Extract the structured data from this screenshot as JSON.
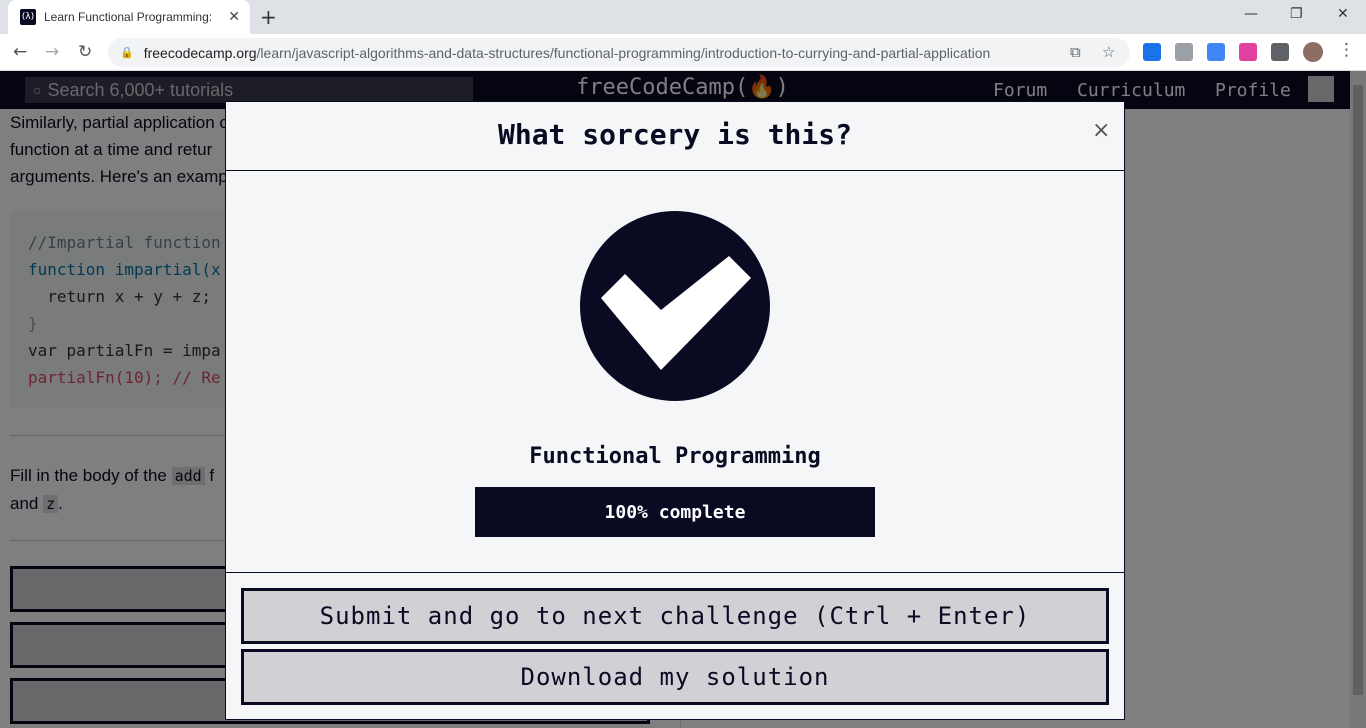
{
  "browser": {
    "tab_title": "Learn Functional Programming: Introduction to Currying and Partial Application",
    "url_host": "freecodecamp.org",
    "url_path": "/learn/javascript-algorithms-and-data-structures/functional-programming/introduction-to-currying-and-partial-application"
  },
  "fcc_nav": {
    "search_placeholder": "Search 6,000+ tutorials",
    "logo": "freeCodeCamp(🔥)",
    "links": [
      "Forum",
      "Curriculum",
      "Profile"
    ]
  },
  "lesson": {
    "para_line1": "Similarly, partial application c",
    "para_line2": "function at a time and retur",
    "para_line3": "arguments. Here's an examp",
    "code_lines": [
      "//Impartial function",
      "function impartial(x",
      "  return x + y + z;",
      "}",
      "var partialFn = impa",
      "partialFn(10); // Re"
    ],
    "instr_line1_a": "Fill in the body of the ",
    "instr_code_add": "add",
    "instr_line1_b": " f",
    "instr_line2_a": "and ",
    "instr_code_z": "z",
    "instr_line2_b": "."
  },
  "modal": {
    "title": "What sorcery is this?",
    "close_label": "×",
    "superblock": "Functional Programming",
    "progress_text": "100% complete",
    "progress_percent": 100,
    "submit_label": "Submit and go to next challenge (Ctrl + Enter)",
    "download_label": "Download my solution"
  },
  "colors": {
    "fcc_dark": "#0a0a23",
    "modal_bg": "#f5f6f7",
    "button_bg": "#d0d0d5"
  }
}
